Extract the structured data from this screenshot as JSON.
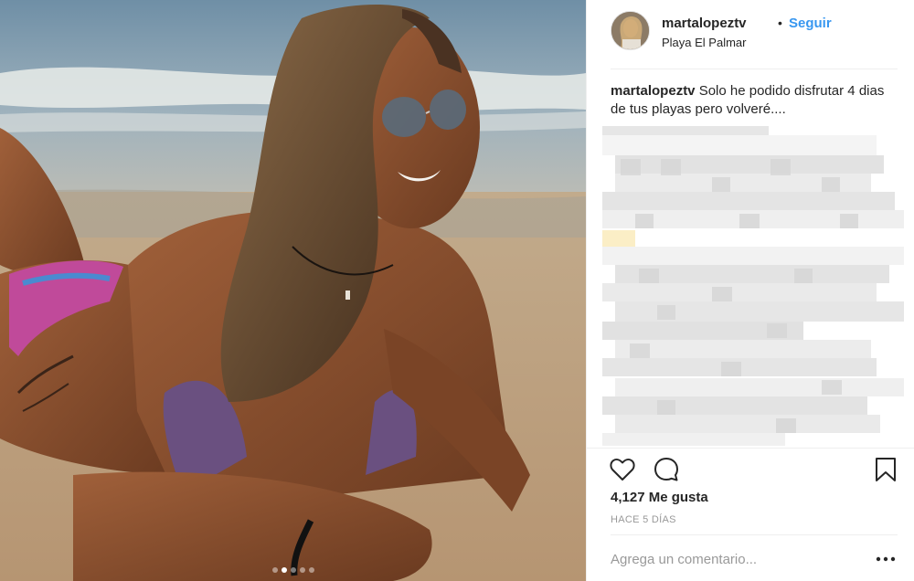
{
  "photo": {
    "carousel_dots": 5,
    "active_dot": 1
  },
  "post": {
    "username": "martalopeztv",
    "separator": "•",
    "follow_label": "Seguir",
    "location": "Playa El Palmar",
    "caption_user": "martalopeztv",
    "caption_text": " Solo he podido disfrutar 4 dias de tus playas pero volveré...."
  },
  "actions": {
    "like_icon": "heart-icon",
    "comment_icon": "comment-bubble-icon",
    "save_icon": "bookmark-icon"
  },
  "stats": {
    "likes": "4,127 Me gusta",
    "time": "HACE 5 DÍAS"
  },
  "comment_box": {
    "placeholder": "Agrega un comentario...",
    "more_icon": "more-options-icon"
  },
  "colors": {
    "accent": "#3897f0",
    "text": "#262626",
    "muted": "#999999",
    "divider": "#efefef"
  }
}
